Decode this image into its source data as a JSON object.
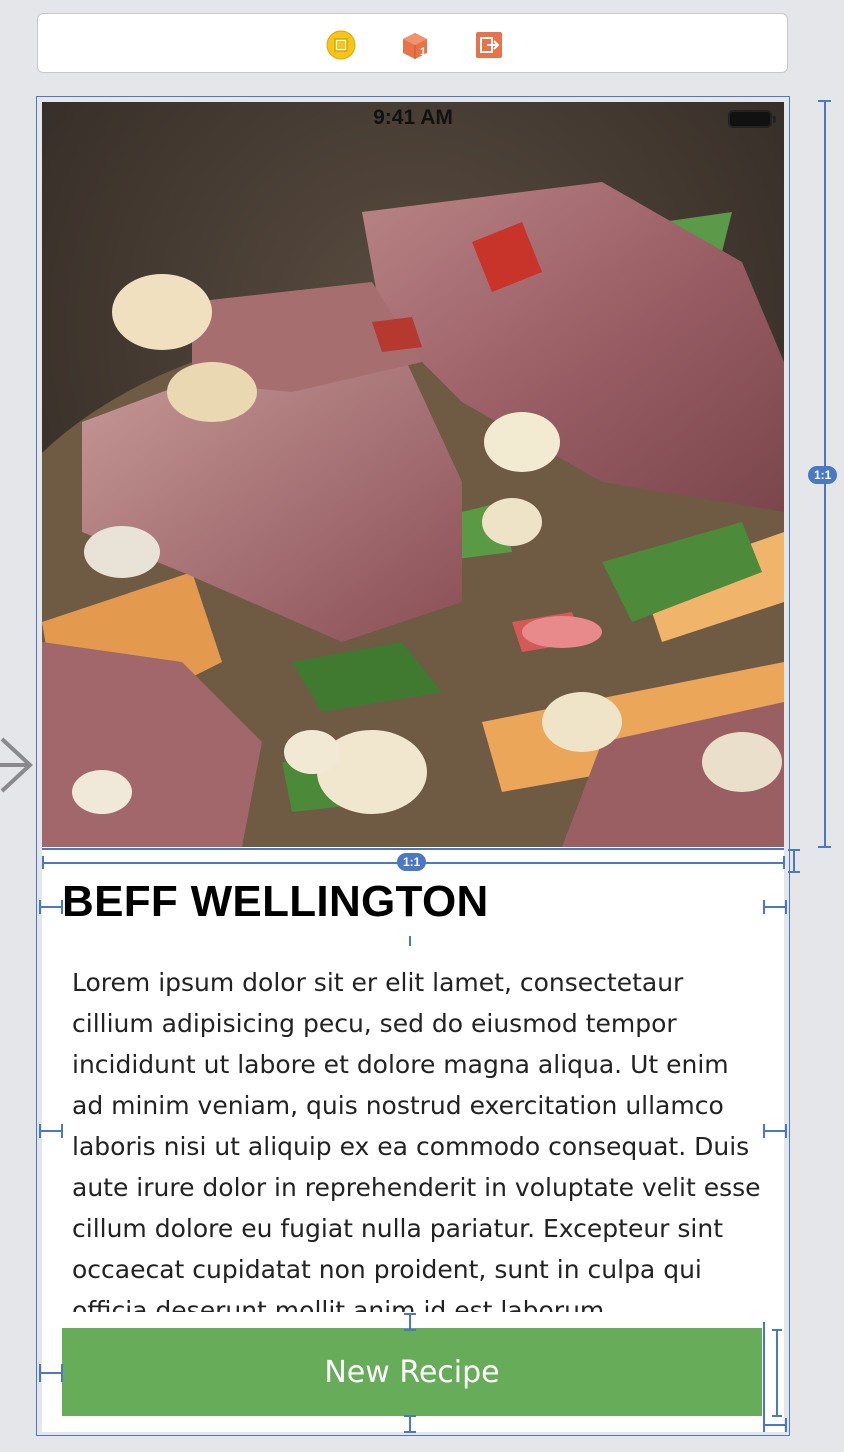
{
  "dock": {
    "icons": [
      "view-controller-icon",
      "first-responder-icon",
      "exit-icon"
    ],
    "colors": {
      "view_controller": "#f5c518",
      "first_responder": "#e8734a",
      "exit": "#e8734a"
    }
  },
  "status_bar": {
    "time": "9:41 AM",
    "battery_icon": "battery-icon"
  },
  "recipe": {
    "title": "BEFF WELLINGTON",
    "description": "Lorem ipsum dolor sit er elit lamet, consectetaur cillium adipisicing pecu, sed do eiusmod tempor incididunt ut labore et dolore magna aliqua. Ut enim ad minim veniam, quis nostrud exercitation ullamco laboris nisi ut aliquip ex ea commodo consequat. Duis aute irure dolor in reprehenderit in voluptate velit esse cillum dolore eu fugiat nulla pariatur. Excepteur sint occaecat cupidatat non proident, sunt in culpa qui officia deserunt mollit anim id est laborum.",
    "button_label": "New Recipe"
  },
  "constraints": {
    "aspect_badge_vertical": "1:1",
    "aspect_badge_horizontal": "1:1"
  },
  "colors": {
    "accent_blue": "#4a78c2",
    "button_green": "#67ac58"
  }
}
